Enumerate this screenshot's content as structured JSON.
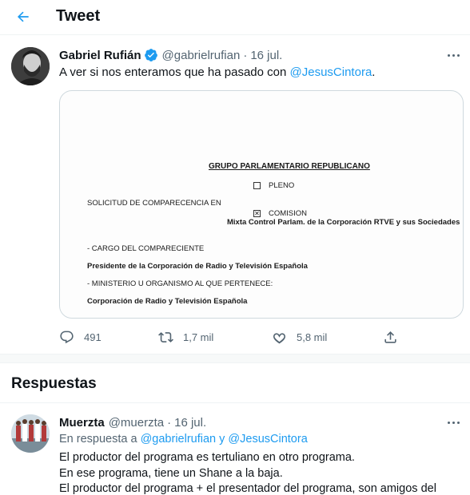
{
  "header": {
    "back_icon": "arrow-left-icon",
    "title": "Tweet"
  },
  "tweet": {
    "display_name": "Gabriel Rufián",
    "verified": true,
    "handle": "@gabrielrufian",
    "separator": "·",
    "time": "16 jul.",
    "text_before": "A ver si nos enteramos que ha pasado con ",
    "mention": "@JesusCintora",
    "text_after": ".",
    "media": {
      "title": "GRUPO PARLAMENTARIO REPUBLICANO",
      "option_pleno": "PLENO",
      "option_comision": "COMISION",
      "comision_checked": true,
      "request_label": "SOLICITUD DE COMPARECENCIA EN",
      "comision_detail": "Mixta Control Parlam. de la Corporación RTVE y sus Sociedades",
      "cargo_label": "- CARGO DEL COMPARECIENTE",
      "cargo_value": "Presidente de la Corporación de Radio y Televisión Española",
      "ministerio_label": "- MINISTERIO U ORGANISMO AL QUE PERTENECE:",
      "ministerio_value": "Corporación de Radio y Televisión Española"
    },
    "actions": {
      "replies": "491",
      "retweets": "1,7 mil",
      "likes": "5,8 mil"
    }
  },
  "replies_section": {
    "title": "Respuestas"
  },
  "reply": {
    "display_name": "Muerzta",
    "handle": "@muerzta",
    "separator": "·",
    "time": "16 jul.",
    "reply_prefix": "En respuesta a ",
    "reply_mention_1": "@gabrielrufian",
    "reply_joiner": " y ",
    "reply_mention_2": "@JesusCintora",
    "lines": [
      "El productor del programa es tertuliano en otro programa.",
      "En ese programa, tiene un Shane a la baja.",
      "El productor del programa + el presentador del programa, son amigos del"
    ]
  },
  "colors": {
    "accent": "#1d9bf0",
    "secondary_text": "#536471",
    "primary_text": "#0f1419",
    "border": "#eff3f4"
  }
}
